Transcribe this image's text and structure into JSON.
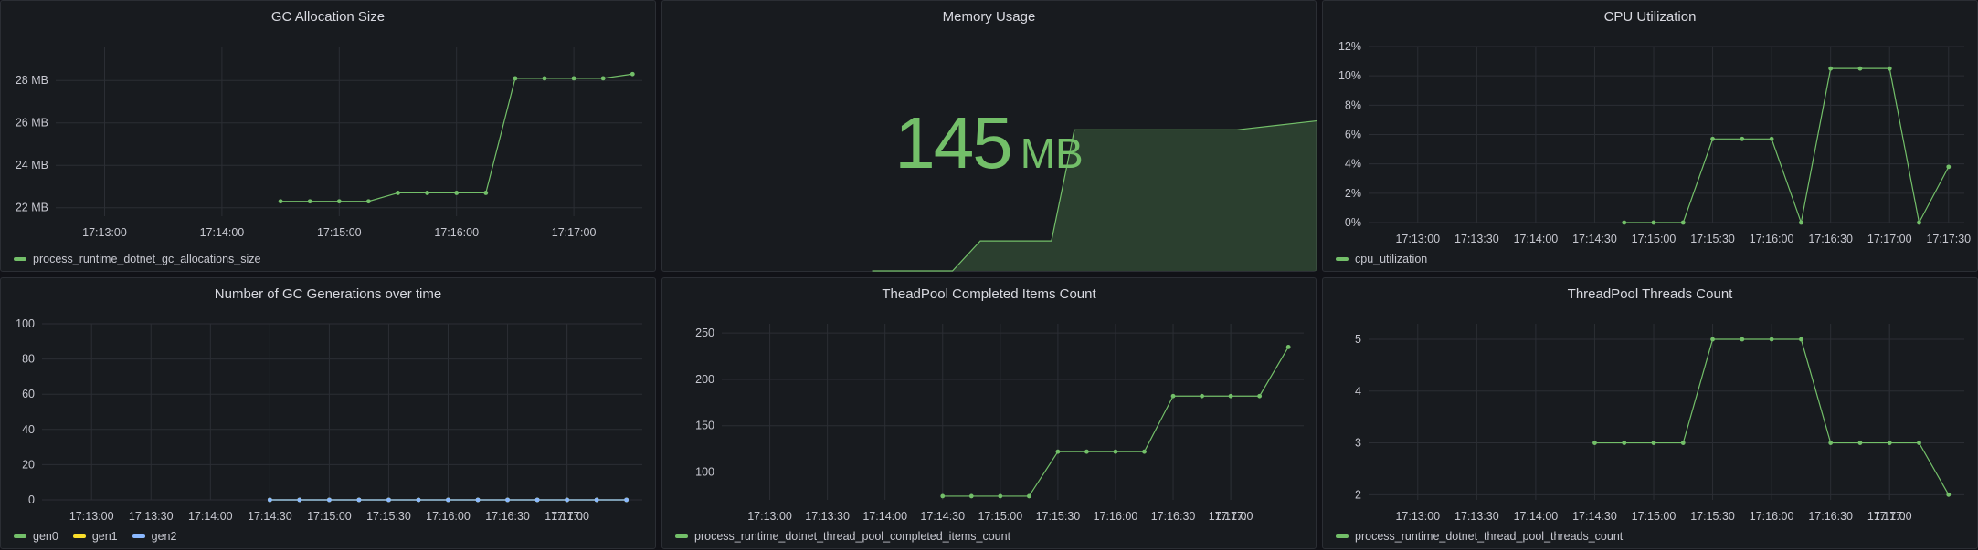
{
  "colors": {
    "green": "#73bf69",
    "yellow": "#fade2a",
    "blue": "#8ab8ff",
    "grid": "#2b2e34",
    "panel": "#181b1f"
  },
  "panels": {
    "gc_alloc": {
      "title": "GC Allocation Size",
      "legend": [
        {
          "label": "process_runtime_dotnet_gc_allocations_size",
          "color": "#73bf69"
        }
      ]
    },
    "memory": {
      "title": "Memory Usage",
      "value": "145",
      "unit": "MB"
    },
    "cpu": {
      "title": "CPU Utilization",
      "legend": [
        {
          "label": "cpu_utilization",
          "color": "#73bf69"
        }
      ]
    },
    "gc_gen": {
      "title": "Number of GC Generations over time",
      "legend": [
        {
          "label": "gen0",
          "color": "#73bf69"
        },
        {
          "label": "gen1",
          "color": "#fade2a"
        },
        {
          "label": "gen2",
          "color": "#8ab8ff"
        }
      ]
    },
    "tp_items": {
      "title": "TheadPool Completed Items Count",
      "legend": [
        {
          "label": "process_runtime_dotnet_thread_pool_completed_items_count",
          "color": "#73bf69"
        }
      ]
    },
    "tp_threads": {
      "title": "ThreadPool Threads Count",
      "legend": [
        {
          "label": "process_runtime_dotnet_thread_pool_threads_count",
          "color": "#73bf69"
        }
      ]
    }
  },
  "chart_data": [
    {
      "id": "gc_alloc",
      "type": "line",
      "title": "GC Allocation Size",
      "x_ticks": [
        "17:13:00",
        "17:14:00",
        "17:15:00",
        "17:16:00",
        "17:17:00"
      ],
      "x_range": [
        "17:12:35",
        "17:17:35"
      ],
      "y_ticks": [
        "22 MB",
        "24 MB",
        "26 MB",
        "28 MB"
      ],
      "y_range": [
        21.6,
        29.6
      ],
      "ylabel_unit": "MB",
      "series": [
        {
          "name": "process_runtime_dotnet_gc_allocations_size",
          "color": "#73bf69",
          "x": [
            "17:14:30",
            "17:14:45",
            "17:15:00",
            "17:15:15",
            "17:15:30",
            "17:15:45",
            "17:16:00",
            "17:16:15",
            "17:16:30",
            "17:16:45",
            "17:17:00",
            "17:17:15",
            "17:17:30"
          ],
          "y": [
            22.3,
            22.3,
            22.3,
            22.3,
            22.7,
            22.7,
            22.7,
            22.7,
            28.1,
            28.1,
            28.1,
            28.1,
            28.3
          ]
        }
      ]
    },
    {
      "id": "memory",
      "type": "area",
      "title": "Memory Usage",
      "series": [
        {
          "name": "memory",
          "color": "#73bf69",
          "x": [
            0.0,
            0.1,
            0.2,
            0.3,
            0.4,
            0.5,
            0.6,
            0.7,
            0.8,
            0.9,
            1.0
          ],
          "y": [
            0,
            0,
            0,
            0,
            0,
            0,
            10,
            10,
            47,
            47,
            50
          ]
        }
      ]
    },
    {
      "id": "cpu",
      "type": "line",
      "title": "CPU Utilization",
      "x_ticks": [
        "17:13:00",
        "17:13:30",
        "17:14:00",
        "17:14:30",
        "17:15:00",
        "17:15:30",
        "17:16:00",
        "17:16:30",
        "17:17:00",
        "17:17:30"
      ],
      "x_range": [
        "17:12:35",
        "17:17:38"
      ],
      "y_ticks": [
        "0%",
        "2%",
        "4%",
        "6%",
        "8%",
        "10%",
        "12%"
      ],
      "y_range": [
        0,
        12
      ],
      "series": [
        {
          "name": "cpu_utilization",
          "color": "#73bf69",
          "x": [
            "17:14:45",
            "17:15:00",
            "17:15:15",
            "17:15:30",
            "17:15:45",
            "17:16:00",
            "17:16:15",
            "17:16:30",
            "17:16:45",
            "17:17:00",
            "17:17:15",
            "17:17:30"
          ],
          "y": [
            0,
            0,
            0,
            5.7,
            5.7,
            5.7,
            0,
            10.5,
            10.5,
            10.5,
            0,
            3.8
          ]
        }
      ]
    },
    {
      "id": "gc_gen",
      "type": "line",
      "title": "Number of GC Generations over time",
      "x_ticks": [
        "17:13:00",
        "17:13:30",
        "17:14:00",
        "17:14:30",
        "17:15:00",
        "17:15:30",
        "17:16:00",
        "17:16:30",
        "17:17:00",
        "17:17:"
      ],
      "x_range": [
        "17:12:35",
        "17:17:38"
      ],
      "y_ticks": [
        "0",
        "20",
        "40",
        "60",
        "80",
        "100"
      ],
      "y_range": [
        0,
        100
      ],
      "series": [
        {
          "name": "gen0",
          "color": "#73bf69",
          "x": [
            "17:14:30",
            "17:14:45",
            "17:15:00",
            "17:15:15",
            "17:15:30",
            "17:15:45",
            "17:16:00",
            "17:16:15",
            "17:16:30",
            "17:16:45",
            "17:17:00",
            "17:17:15",
            "17:17:30"
          ],
          "y": [
            0,
            0,
            0,
            0,
            0,
            0,
            0,
            0,
            0,
            0,
            0,
            0,
            0
          ]
        },
        {
          "name": "gen1",
          "color": "#fade2a",
          "x": [
            "17:14:30",
            "17:14:45",
            "17:15:00",
            "17:15:15",
            "17:15:30",
            "17:15:45",
            "17:16:00",
            "17:16:15",
            "17:16:30",
            "17:16:45",
            "17:17:00",
            "17:17:15",
            "17:17:30"
          ],
          "y": [
            0,
            0,
            0,
            0,
            0,
            0,
            0,
            0,
            0,
            0,
            0,
            0,
            0
          ]
        },
        {
          "name": "gen2",
          "color": "#8ab8ff",
          "x": [
            "17:14:30",
            "17:14:45",
            "17:15:00",
            "17:15:15",
            "17:15:30",
            "17:15:45",
            "17:16:00",
            "17:16:15",
            "17:16:30",
            "17:16:45",
            "17:17:00",
            "17:17:15",
            "17:17:30"
          ],
          "y": [
            0,
            0,
            0,
            0,
            0,
            0,
            0,
            0,
            0,
            0,
            0,
            0,
            0
          ]
        }
      ]
    },
    {
      "id": "tp_items",
      "type": "line",
      "title": "TheadPool Completed Items Count",
      "x_ticks": [
        "17:13:00",
        "17:13:30",
        "17:14:00",
        "17:14:30",
        "17:15:00",
        "17:15:30",
        "17:16:00",
        "17:16:30",
        "17:17:00",
        "17:17:"
      ],
      "x_range": [
        "17:12:35",
        "17:17:38"
      ],
      "y_ticks": [
        "100",
        "150",
        "200",
        "250"
      ],
      "y_range": [
        70,
        260
      ],
      "series": [
        {
          "name": "process_runtime_dotnet_thread_pool_completed_items_count",
          "color": "#73bf69",
          "x": [
            "17:14:30",
            "17:14:45",
            "17:15:00",
            "17:15:15",
            "17:15:30",
            "17:15:45",
            "17:16:00",
            "17:16:15",
            "17:16:30",
            "17:16:45",
            "17:17:00",
            "17:17:15",
            "17:17:30"
          ],
          "y": [
            74,
            74,
            74,
            74,
            122,
            122,
            122,
            122,
            182,
            182,
            182,
            182,
            235
          ]
        }
      ]
    },
    {
      "id": "tp_threads",
      "type": "line",
      "title": "ThreadPool Threads Count",
      "x_ticks": [
        "17:13:00",
        "17:13:30",
        "17:14:00",
        "17:14:30",
        "17:15:00",
        "17:15:30",
        "17:16:00",
        "17:16:30",
        "17:17:00",
        "17:17:"
      ],
      "x_range": [
        "17:12:35",
        "17:17:38"
      ],
      "y_ticks": [
        "2",
        "3",
        "4",
        "5"
      ],
      "y_range": [
        1.9,
        5.3
      ],
      "series": [
        {
          "name": "process_runtime_dotnet_thread_pool_threads_count",
          "color": "#73bf69",
          "x": [
            "17:14:30",
            "17:14:45",
            "17:15:00",
            "17:15:15",
            "17:15:30",
            "17:15:45",
            "17:16:00",
            "17:16:15",
            "17:16:30",
            "17:16:45",
            "17:17:00",
            "17:17:15",
            "17:17:30"
          ],
          "y": [
            3,
            3,
            3,
            3,
            5,
            5,
            5,
            5,
            3,
            3,
            3,
            3,
            2
          ]
        }
      ]
    }
  ]
}
